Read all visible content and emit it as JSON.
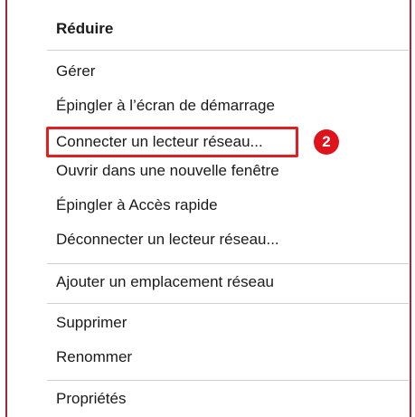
{
  "menu": {
    "items": [
      {
        "label": "Réduire"
      },
      {
        "label": "Gérer"
      },
      {
        "label": "Épingler à l’écran de démarrage"
      },
      {
        "label": "Connecter un lecteur réseau..."
      },
      {
        "label": "Ouvrir dans une nouvelle fenêtre"
      },
      {
        "label": "Épingler à Accès rapide"
      },
      {
        "label": "Déconnecter un lecteur réseau..."
      },
      {
        "label": "Ajouter un emplacement réseau"
      },
      {
        "label": "Supprimer"
      },
      {
        "label": "Renommer"
      },
      {
        "label": "Propriétés"
      }
    ]
  },
  "annotation": {
    "badge": "2",
    "highlight_color": "#e02020",
    "badge_color": "#e0121b"
  },
  "frame_color": "#a1283c"
}
